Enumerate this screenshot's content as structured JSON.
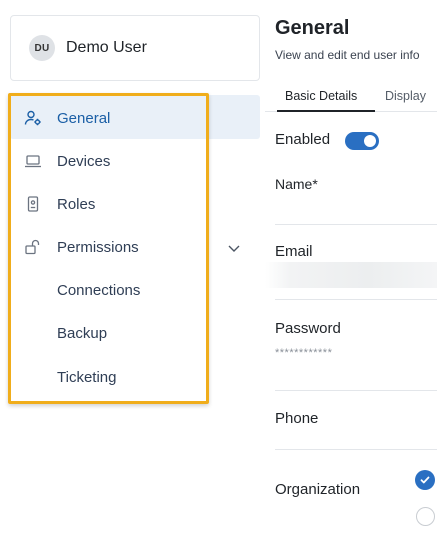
{
  "user": {
    "initials": "DU",
    "name": "Demo User"
  },
  "sidebar": {
    "items": [
      {
        "label": "General",
        "icon": "user-gear-icon",
        "active": true
      },
      {
        "label": "Devices",
        "icon": "laptop-icon"
      },
      {
        "label": "Roles",
        "icon": "id-badge-icon"
      },
      {
        "label": "Permissions",
        "icon": "unlock-icon",
        "expandable": true
      },
      {
        "label": "Connections"
      },
      {
        "label": "Backup"
      },
      {
        "label": "Ticketing"
      }
    ],
    "highlight_color": "#f0ad1b",
    "active_color": "#1b5fa6"
  },
  "main": {
    "title": "General",
    "subtitle": "View and edit end user info",
    "tabs": [
      "Basic Details",
      "Display"
    ],
    "fields": {
      "enabled_label": "Enabled",
      "name_label": "Name*",
      "email_label": "Email",
      "password_label": "Password",
      "password_masked": "************",
      "phone_label": "Phone",
      "organization_label": "Organization"
    },
    "accent_color": "#2a6fc2"
  }
}
